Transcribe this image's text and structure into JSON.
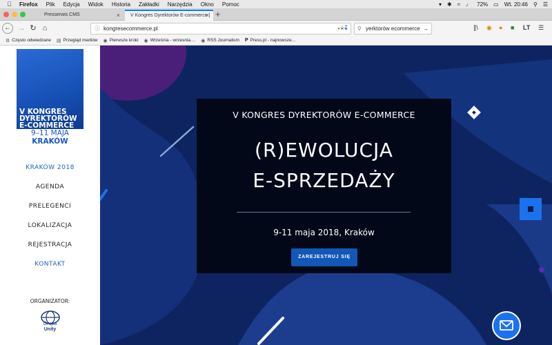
{
  "menubar": {
    "apple_icon": "apple-icon",
    "app_name": "Firefox",
    "items": [
      "Plik",
      "Edycja",
      "Widok",
      "Historia",
      "Zakładki",
      "Narzędzia",
      "Okno",
      "Pomoc"
    ],
    "battery": "72%",
    "clock": "Wt. 20:46"
  },
  "tabs": [
    {
      "label": "Presserwis CMS",
      "active": false
    },
    {
      "label": "V Kongres Dyrektorów E-commerce |",
      "active": true
    }
  ],
  "navbar": {
    "url": "kongresecommerce.pl",
    "url_actions": "•••",
    "search_value": "yerktorów ecommerce"
  },
  "bookmarks": [
    {
      "label": "Często odwiedzane",
      "icon": "gear-icon"
    },
    {
      "label": "Przegląd mediów",
      "icon": "folder-icon"
    },
    {
      "label": "Pierwsze kroki",
      "icon": "globe-icon"
    },
    {
      "label": "Września - wrzesnia....",
      "icon": "globe-icon"
    },
    {
      "label": "RSS Journalism",
      "icon": "globe-icon"
    },
    {
      "label": "Press.pl - najnowsze...",
      "icon": "press-icon"
    }
  ],
  "sidebar": {
    "logo_lines": [
      "V KONGRES",
      "DYREKTORÓW",
      "E-COMMERCE"
    ],
    "logo_dates": "9–11 MAJA",
    "logo_city": "KRAKÓW",
    "nav": [
      {
        "label": "KRAKÓW 2018",
        "highlight": true
      },
      {
        "label": "AGENDA",
        "highlight": false
      },
      {
        "label": "PRELEGENCI",
        "highlight": false
      },
      {
        "label": "LOKALIZACJA",
        "highlight": false
      },
      {
        "label": "REJESTRACJA",
        "highlight": false
      },
      {
        "label": "KONTAKT",
        "highlight": true
      }
    ],
    "organizer_label": "ORGANIZATOR:",
    "organizer_name_1": "Grupa",
    "organizer_name_2": "Unity"
  },
  "hero": {
    "title": "V KONGRES DYREKTORÓW E-COMMERCE",
    "headline_1": "(R)EWOLUCJA",
    "headline_2": "E-SPRZEDAŻY",
    "dates": "9-11 maja 2018, Kraków",
    "cta": "ZAREJESTRUJ SIĘ"
  },
  "colors": {
    "brand_blue": "#1357b8",
    "hero_bg": "#0d1f57",
    "accent": "#1c72ec"
  }
}
